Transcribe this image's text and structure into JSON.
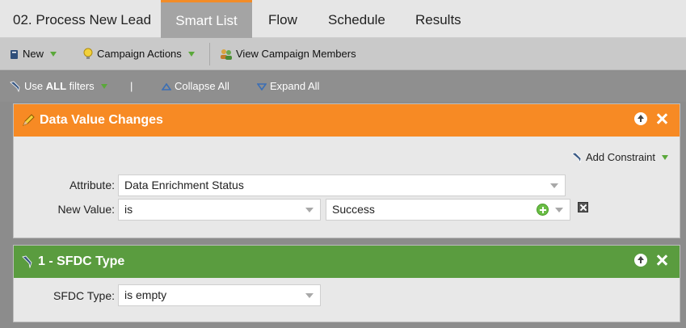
{
  "tabs": {
    "title": "02. Process New Lead",
    "smart_list": "Smart List",
    "flow": "Flow",
    "schedule": "Schedule",
    "results": "Results"
  },
  "toolbar": {
    "new_label": "New",
    "campaign_actions_label": "Campaign Actions",
    "view_members_label": "View Campaign Members"
  },
  "filterbar": {
    "use_prefix": "Use ",
    "use_all": "ALL",
    "use_suffix": " filters",
    "separator": "|",
    "collapse_all": "Collapse All",
    "expand_all": "Expand All"
  },
  "filters": [
    {
      "title": "Data Value Changes",
      "add_constraint": "Add Constraint",
      "attribute_label": "Attribute:",
      "attribute_value": "Data Enrichment Status",
      "new_value_label": "New Value:",
      "operator": "is",
      "value": "Success"
    },
    {
      "title": "1 - SFDC Type",
      "field_label": "SFDC Type:",
      "operator": "is empty"
    }
  ],
  "colors": {
    "accent_orange": "#f78a24",
    "accent_green": "#5a9c3f"
  }
}
